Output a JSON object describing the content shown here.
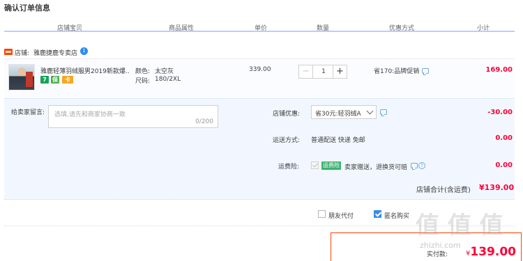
{
  "page": {
    "title": "确认订单信息"
  },
  "columns": [
    "店铺宝贝",
    "商品属性",
    "单价",
    "数量",
    "优惠方式",
    "小计"
  ],
  "store": {
    "label": "店铺:",
    "name": "雅鹿捷鹿专卖店",
    "badge": "1"
  },
  "item": {
    "title": "雅鹿轻薄羽绒服男2019新款爆...",
    "icons": [
      "7",
      "保",
      "卡"
    ],
    "color_label": "颜色:",
    "color_value": "太空灰",
    "size_label": "尺码:",
    "size_value": "180/2XL",
    "price": "339.00",
    "quantity": "1",
    "promo": "省170:品牌促销",
    "subtotal": "169.00"
  },
  "memo": {
    "label": "给卖家留言:",
    "placeholder": "选填,请先和商家协商一致",
    "count": "0/200"
  },
  "discount": {
    "label": "店铺优惠:",
    "selected": "省30元:轻羽绒A",
    "amount": "-30.00"
  },
  "shipping": {
    "label": "运送方式:",
    "value": "普通配送 快递 免邮",
    "amount": "0.00"
  },
  "insurance": {
    "label": "运费险:",
    "badge": "运费险",
    "text": "卖家赠送，退换货可赔",
    "amount": "0.00"
  },
  "store_total": {
    "label": "店铺合计(含运费)",
    "amount": "¥139.00"
  },
  "options": {
    "friend_pay": "朋友代付",
    "anonymous": "匿名购买"
  },
  "payment": {
    "label": "实付款:",
    "currency": "¥",
    "amount": "139.00"
  },
  "watermark": {
    "logo": "值 值 值",
    "site": "zhizhi.com"
  },
  "colors": {
    "accent_red": "#ff0036",
    "header_line": "#b2d1ff",
    "pay_border": "#ff4400"
  }
}
